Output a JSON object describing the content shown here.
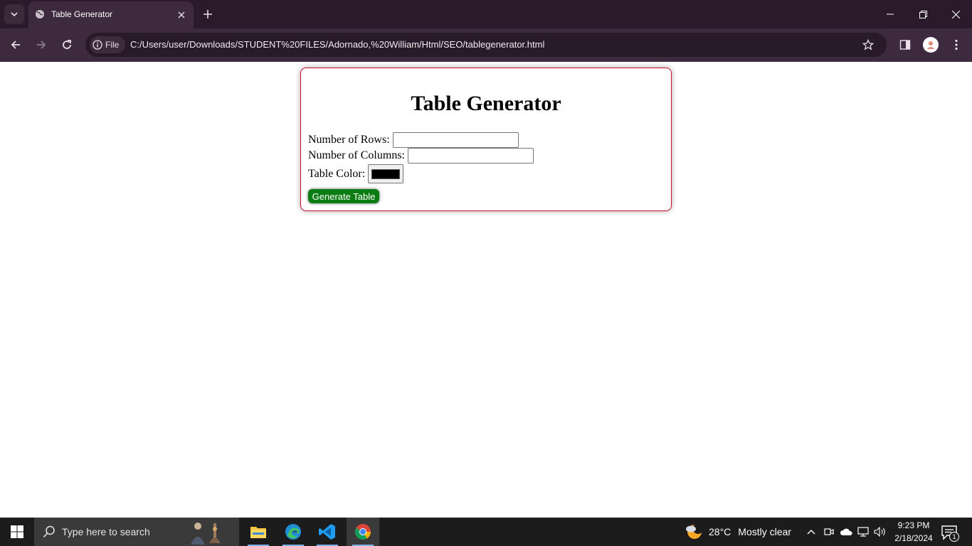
{
  "browser": {
    "tab_title": "Table Generator",
    "chip_label": "File",
    "url": "C:/Users/user/Downloads/STUDENT%20FILES/Adornado,%20William/Html/SEO/tablegenerator.html"
  },
  "page": {
    "heading": "Table Generator",
    "rows_label": "Number of Rows:",
    "rows_value": "",
    "columns_label": "Number of Columns:",
    "columns_value": "",
    "color_label": "Table Color:",
    "color_value": "#000000",
    "button_label": "Generate Table",
    "accent_border": "#c8102e",
    "button_color": "#0a7d12"
  },
  "taskbar": {
    "search_placeholder": "Type here to search",
    "apps": [
      "file-explorer-icon",
      "edge-icon",
      "vscode-icon",
      "chrome-icon"
    ],
    "weather_temp": "28°C",
    "weather_condition": "Mostly clear",
    "time": "9:23 PM",
    "date": "2/18/2024",
    "notification_count": "1"
  }
}
